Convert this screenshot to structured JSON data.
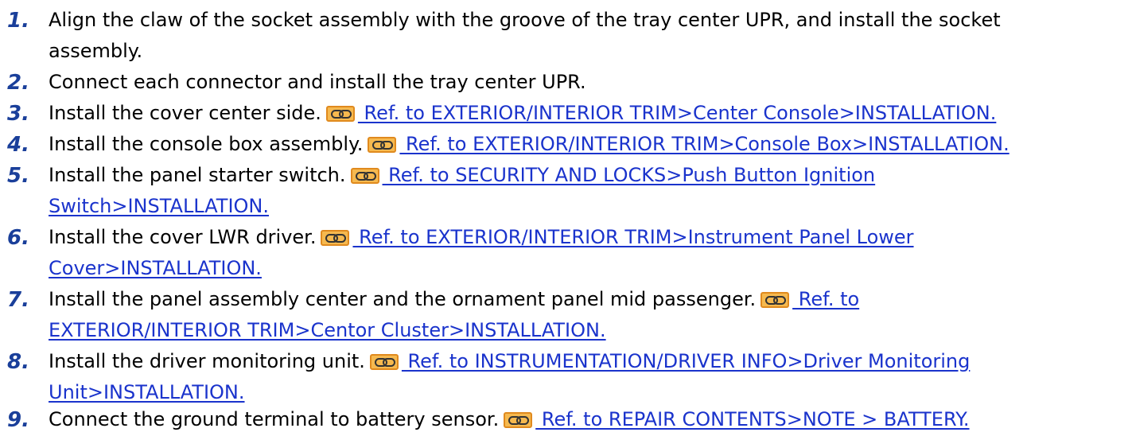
{
  "steps": [
    {
      "number": "1.",
      "text": "Align the claw of the socket assembly with the groove of the tray center UPR, and install the socket",
      "text_cont": "assembly."
    },
    {
      "number": "2.",
      "text": "Connect each connector and install the tray center UPR."
    },
    {
      "number": "3.",
      "text": "Install the cover center side.",
      "link": " Ref. to EXTERIOR/INTERIOR TRIM>Center Console>INSTALLATION."
    },
    {
      "number": "4.",
      "text": "Install the console box assembly.",
      "link": " Ref. to EXTERIOR/INTERIOR TRIM>Console Box>INSTALLATION."
    },
    {
      "number": "5.",
      "text": "Install the panel starter switch.",
      "link": " Ref. to SECURITY AND LOCKS>Push Button Ignition",
      "link_cont": "Switch>INSTALLATION."
    },
    {
      "number": "6.",
      "text": "Install the cover LWR driver.",
      "link": " Ref. to EXTERIOR/INTERIOR TRIM>Instrument Panel Lower",
      "link_cont": "Cover>INSTALLATION."
    },
    {
      "number": "7.",
      "text": "Install the panel assembly center and the ornament panel mid passenger.",
      "link": " Ref. to",
      "link_cont": "EXTERIOR/INTERIOR TRIM>Centor Cluster>INSTALLATION."
    },
    {
      "number": "8.",
      "text": "Install the driver monitoring unit.",
      "link": " Ref. to INSTRUMENTATION/DRIVER INFO>Driver Monitoring",
      "link_cont": "Unit>INSTALLATION."
    },
    {
      "number": "9.",
      "text": "Connect the ground terminal to battery sensor.",
      "link": " Ref. to REPAIR CONTENTS>NOTE > BATTERY."
    }
  ],
  "icons": {
    "reference": "chain-link-icon"
  },
  "colors": {
    "step_number": "#1a3f9a",
    "link": "#1a33cc",
    "icon_fill": "#f6b94f",
    "icon_border": "#e08a1e"
  }
}
